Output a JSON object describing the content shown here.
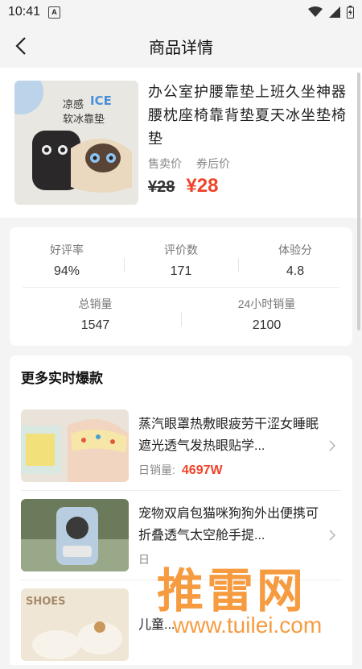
{
  "status": {
    "time": "10:41",
    "badge": "A"
  },
  "header": {
    "title": "商品详情"
  },
  "product": {
    "name": "办公室护腰靠垫上班久坐神器腰枕座椅靠背垫夏天冰坐垫椅垫",
    "image_caption": "凉感ICE软冰靠垫",
    "price_label": "售卖价",
    "coupon_label": "券后价",
    "old_price": "¥28",
    "new_price": "¥28"
  },
  "stats": {
    "row1": [
      {
        "label": "好评率",
        "value": "94%"
      },
      {
        "label": "评价数",
        "value": "171"
      },
      {
        "label": "体验分",
        "value": "4.8"
      }
    ],
    "row2": [
      {
        "label": "总销量",
        "value": "1547"
      },
      {
        "label": "24小时销量",
        "value": "2100"
      }
    ]
  },
  "more": {
    "title": "更多实时爆款",
    "items": [
      {
        "name": "蒸汽眼罩热敷眼疲劳干涩女睡眠遮光透气发热眼贴学...",
        "sales_label": "日销量:",
        "sales": "4697W"
      },
      {
        "name": "宠物双肩包猫咪狗狗外出便携可折叠透气太空舱手提...",
        "sales_label": "日",
        "sales": ""
      },
      {
        "name": "儿童...",
        "sales_label": "",
        "sales": ""
      }
    ]
  },
  "watermark": {
    "text": "推雷网",
    "url": "www.tuilei.com"
  },
  "colors": {
    "accent": "#f0442a",
    "watermark": "#f58a1f"
  }
}
